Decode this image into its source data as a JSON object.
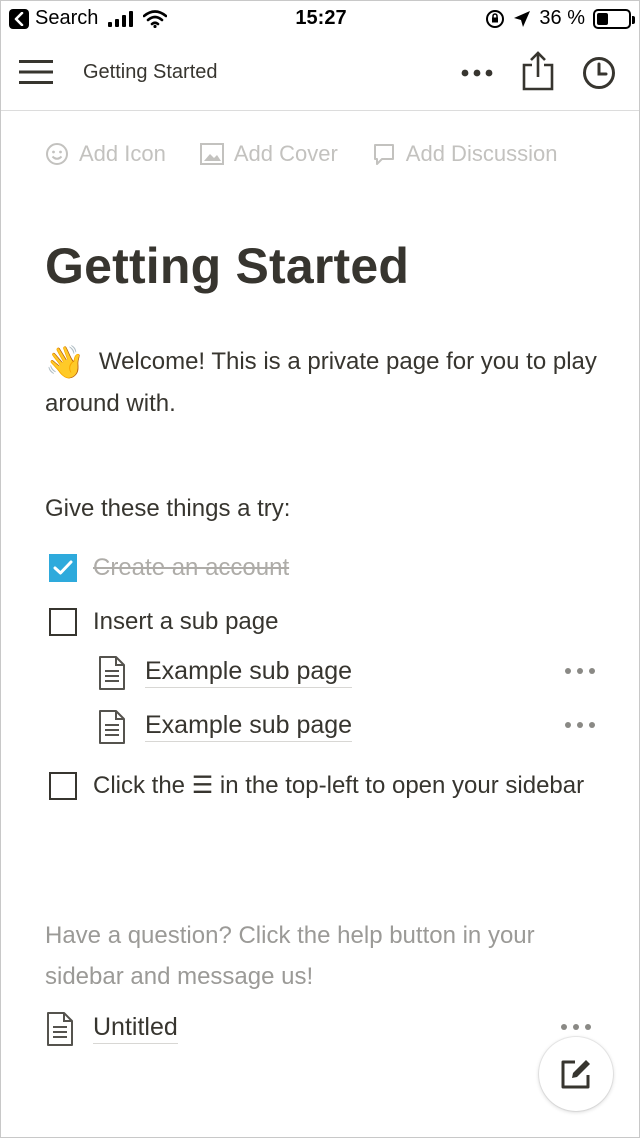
{
  "status_bar": {
    "back_label": "Search",
    "time": "15:27",
    "battery_percent": "36 %",
    "battery_level": 0.36
  },
  "nav": {
    "title": "Getting Started"
  },
  "add_controls": {
    "icon": "Add Icon",
    "cover": "Add Cover",
    "discussion": "Add Discussion"
  },
  "page": {
    "title": "Getting Started",
    "welcome_emoji": "👋",
    "welcome_text": "Welcome! This is a private page for you to play around with.",
    "try_heading": "Give these things a try:",
    "todos": [
      {
        "text": "Create an account",
        "checked": true
      },
      {
        "text": "Insert a sub page",
        "checked": false
      },
      {
        "text": "Click the ☰ in the top-left to open your sidebar",
        "checked": false
      }
    ],
    "subpages": [
      {
        "title": "Example sub page"
      },
      {
        "title": "Example sub page"
      }
    ],
    "help_text": "Have a question? Click the help button in your sidebar and message us!",
    "untitled": "Untitled"
  },
  "colors": {
    "text": "#37352f",
    "muted": "#9b9a97",
    "faint": "#c3c2bf",
    "checkbox_accent": "#2eaadc"
  }
}
